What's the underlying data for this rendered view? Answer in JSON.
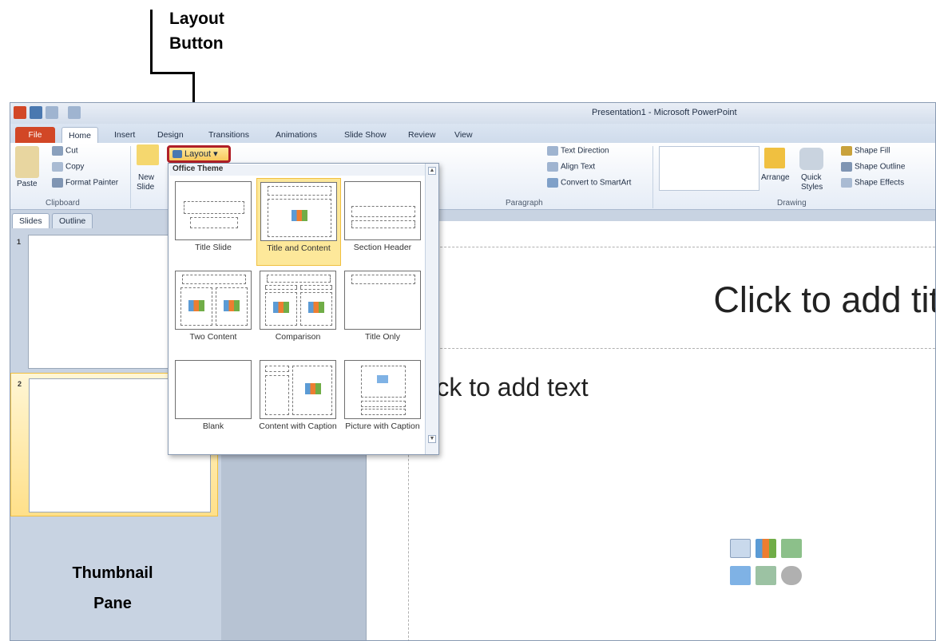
{
  "annotation": {
    "label_line1": "Layout",
    "label_line2": "Button",
    "pane_label_line1": "Thumbnail",
    "pane_label_line2": "Pane"
  },
  "app": {
    "window_title": "Presentation1  -  Microsoft PowerPoint"
  },
  "tabs": [
    "File",
    "Home",
    "Insert",
    "Design",
    "Transitions",
    "Animations",
    "Slide Show",
    "Review",
    "View"
  ],
  "clipboard": {
    "paste": "Paste",
    "cut": "Cut",
    "copy": "Copy",
    "format_painter": "Format Painter",
    "group": "Clipboard"
  },
  "slides": {
    "new_slide_line1": "New",
    "new_slide_line2": "Slide",
    "layout": "Layout"
  },
  "paragraph": {
    "text_direction": "Text Direction",
    "align_text": "Align Text",
    "convert_smartart": "Convert to SmartArt",
    "group": "Paragraph"
  },
  "drawing": {
    "arrange": "Arrange",
    "quick_styles_line1": "Quick",
    "quick_styles_line2": "Styles",
    "shape_fill": "Shape Fill",
    "shape_outline": "Shape Outline",
    "shape_effects": "Shape Effects",
    "group": "Drawing"
  },
  "pane_tabs": {
    "slides": "Slides",
    "outline": "Outline"
  },
  "thumbs": [
    "1",
    "2"
  ],
  "slide": {
    "title_placeholder": "Click to add title",
    "body_placeholder": "Click to add text"
  },
  "layout_menu": {
    "header": "Office Theme",
    "items": [
      "Title Slide",
      "Title and Content",
      "Section Header",
      "Two Content",
      "Comparison",
      "Title Only",
      "Blank",
      "Content with Caption",
      "Picture with Caption"
    ],
    "selected": "Title and Content"
  },
  "colors": {
    "file_tab": "#d24726",
    "highlight": "#b01f27",
    "selected_layout": "#fde89a"
  },
  "icons": [
    "paste-icon",
    "cut-icon",
    "copy-icon",
    "format-painter-icon",
    "new-slide-icon",
    "layout-icon",
    "table-icon",
    "chart-icon",
    "smartart-icon",
    "picture-icon",
    "clipart-icon",
    "media-icon"
  ]
}
